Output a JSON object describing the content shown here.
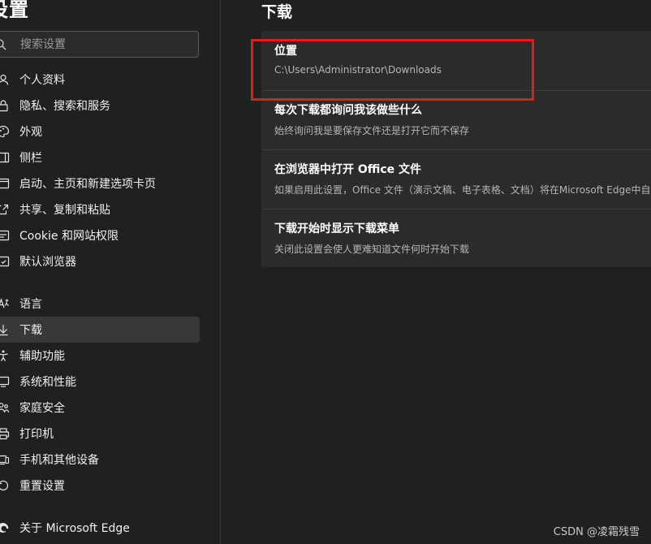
{
  "sidebar": {
    "title": "设置",
    "search_placeholder": "搜索设置",
    "items": [
      {
        "label": "个人资料",
        "icon": "profile-icon"
      },
      {
        "label": "隐私、搜索和服务",
        "icon": "lock-icon"
      },
      {
        "label": "外观",
        "icon": "palette-icon"
      },
      {
        "label": "侧栏",
        "icon": "sidebar-icon"
      },
      {
        "label": "启动、主页和新建选项卡页",
        "icon": "home-icon"
      },
      {
        "label": "共享、复制和粘贴",
        "icon": "share-icon"
      },
      {
        "label": "Cookie 和网站权限",
        "icon": "site-permissions-icon"
      },
      {
        "label": "默认浏览器",
        "icon": "browser-icon"
      },
      {
        "label": "语言",
        "icon": "language-icon"
      },
      {
        "label": "下载",
        "icon": "download-icon",
        "active": true
      },
      {
        "label": "辅助功能",
        "icon": "accessibility-icon"
      },
      {
        "label": "系统和性能",
        "icon": "system-icon"
      },
      {
        "label": "家庭安全",
        "icon": "family-icon"
      },
      {
        "label": "打印机",
        "icon": "printer-icon"
      },
      {
        "label": "手机和其他设备",
        "icon": "phone-icon"
      },
      {
        "label": "重置设置",
        "icon": "reset-icon"
      },
      {
        "label": "关于 Microsoft Edge",
        "icon": "edge-icon"
      }
    ]
  },
  "main": {
    "title": "下载",
    "settings": [
      {
        "title": "位置",
        "description": "C:\\Users\\Administrator\\Downloads"
      },
      {
        "title": "每次下载都询问我该做些什么",
        "description": "始终询问我是要保存文件还是打开它而不保存"
      },
      {
        "title": "在浏览器中打开 Office 文件",
        "description": "如果启用此设置，Office 文件（演示文稿、电子表格、文档）将在Microsoft Edge中自动"
      },
      {
        "title": "下载开始时显示下载菜单",
        "description": "关闭此设置会使人更难知道文件何时开始下载"
      }
    ]
  },
  "annotation": {
    "color": "#e01d1d"
  },
  "watermark": "CSDN @凌霜残雪"
}
